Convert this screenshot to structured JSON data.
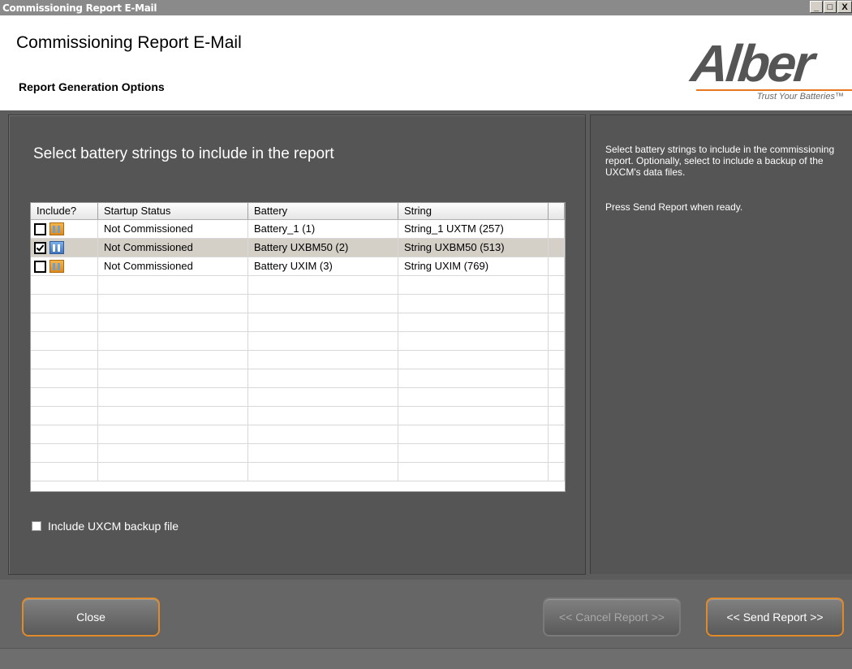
{
  "window": {
    "title": "Commissioning Report E-Mail",
    "minimize": "_",
    "maximize": "□",
    "close": "X"
  },
  "header": {
    "title": "Commissioning Report E-Mail",
    "subtitle": "Report Generation Options",
    "logo_text": "Alber",
    "logo_tagline": "Trust Your Batteries™",
    "accent_color": "#e87722"
  },
  "left_panel": {
    "heading": "Select battery strings to include in the report"
  },
  "grid": {
    "columns": [
      "Include?",
      "Startup Status",
      "Battery",
      "String"
    ],
    "rows": [
      {
        "checked": false,
        "icon": "battery-string-icon",
        "status": "Not Commissioned",
        "battery": "Battery_1 (1)",
        "string": "String_1 UXTM (257)"
      },
      {
        "checked": true,
        "icon": "battery-multi-icon",
        "status": "Not Commissioned",
        "battery": "Battery UXBM50 (2)",
        "string": "String UXBM50 (513)"
      },
      {
        "checked": false,
        "icon": "battery-string-icon",
        "status": "Not Commissioned",
        "battery": "Battery UXIM (3)",
        "string": "String UXIM (769)"
      }
    ]
  },
  "backup": {
    "label": "Include UXCM backup file",
    "checked": false
  },
  "right_panel": {
    "help": "Select battery strings to include in the commissioning report.  Optionally, select to include a backup of the UXCM's data files.",
    "help2": "Press Send Report when ready."
  },
  "footer": {
    "close_label": "Close",
    "cancel_label": "<< Cancel Report >>",
    "send_label": "<< Send Report >>"
  }
}
